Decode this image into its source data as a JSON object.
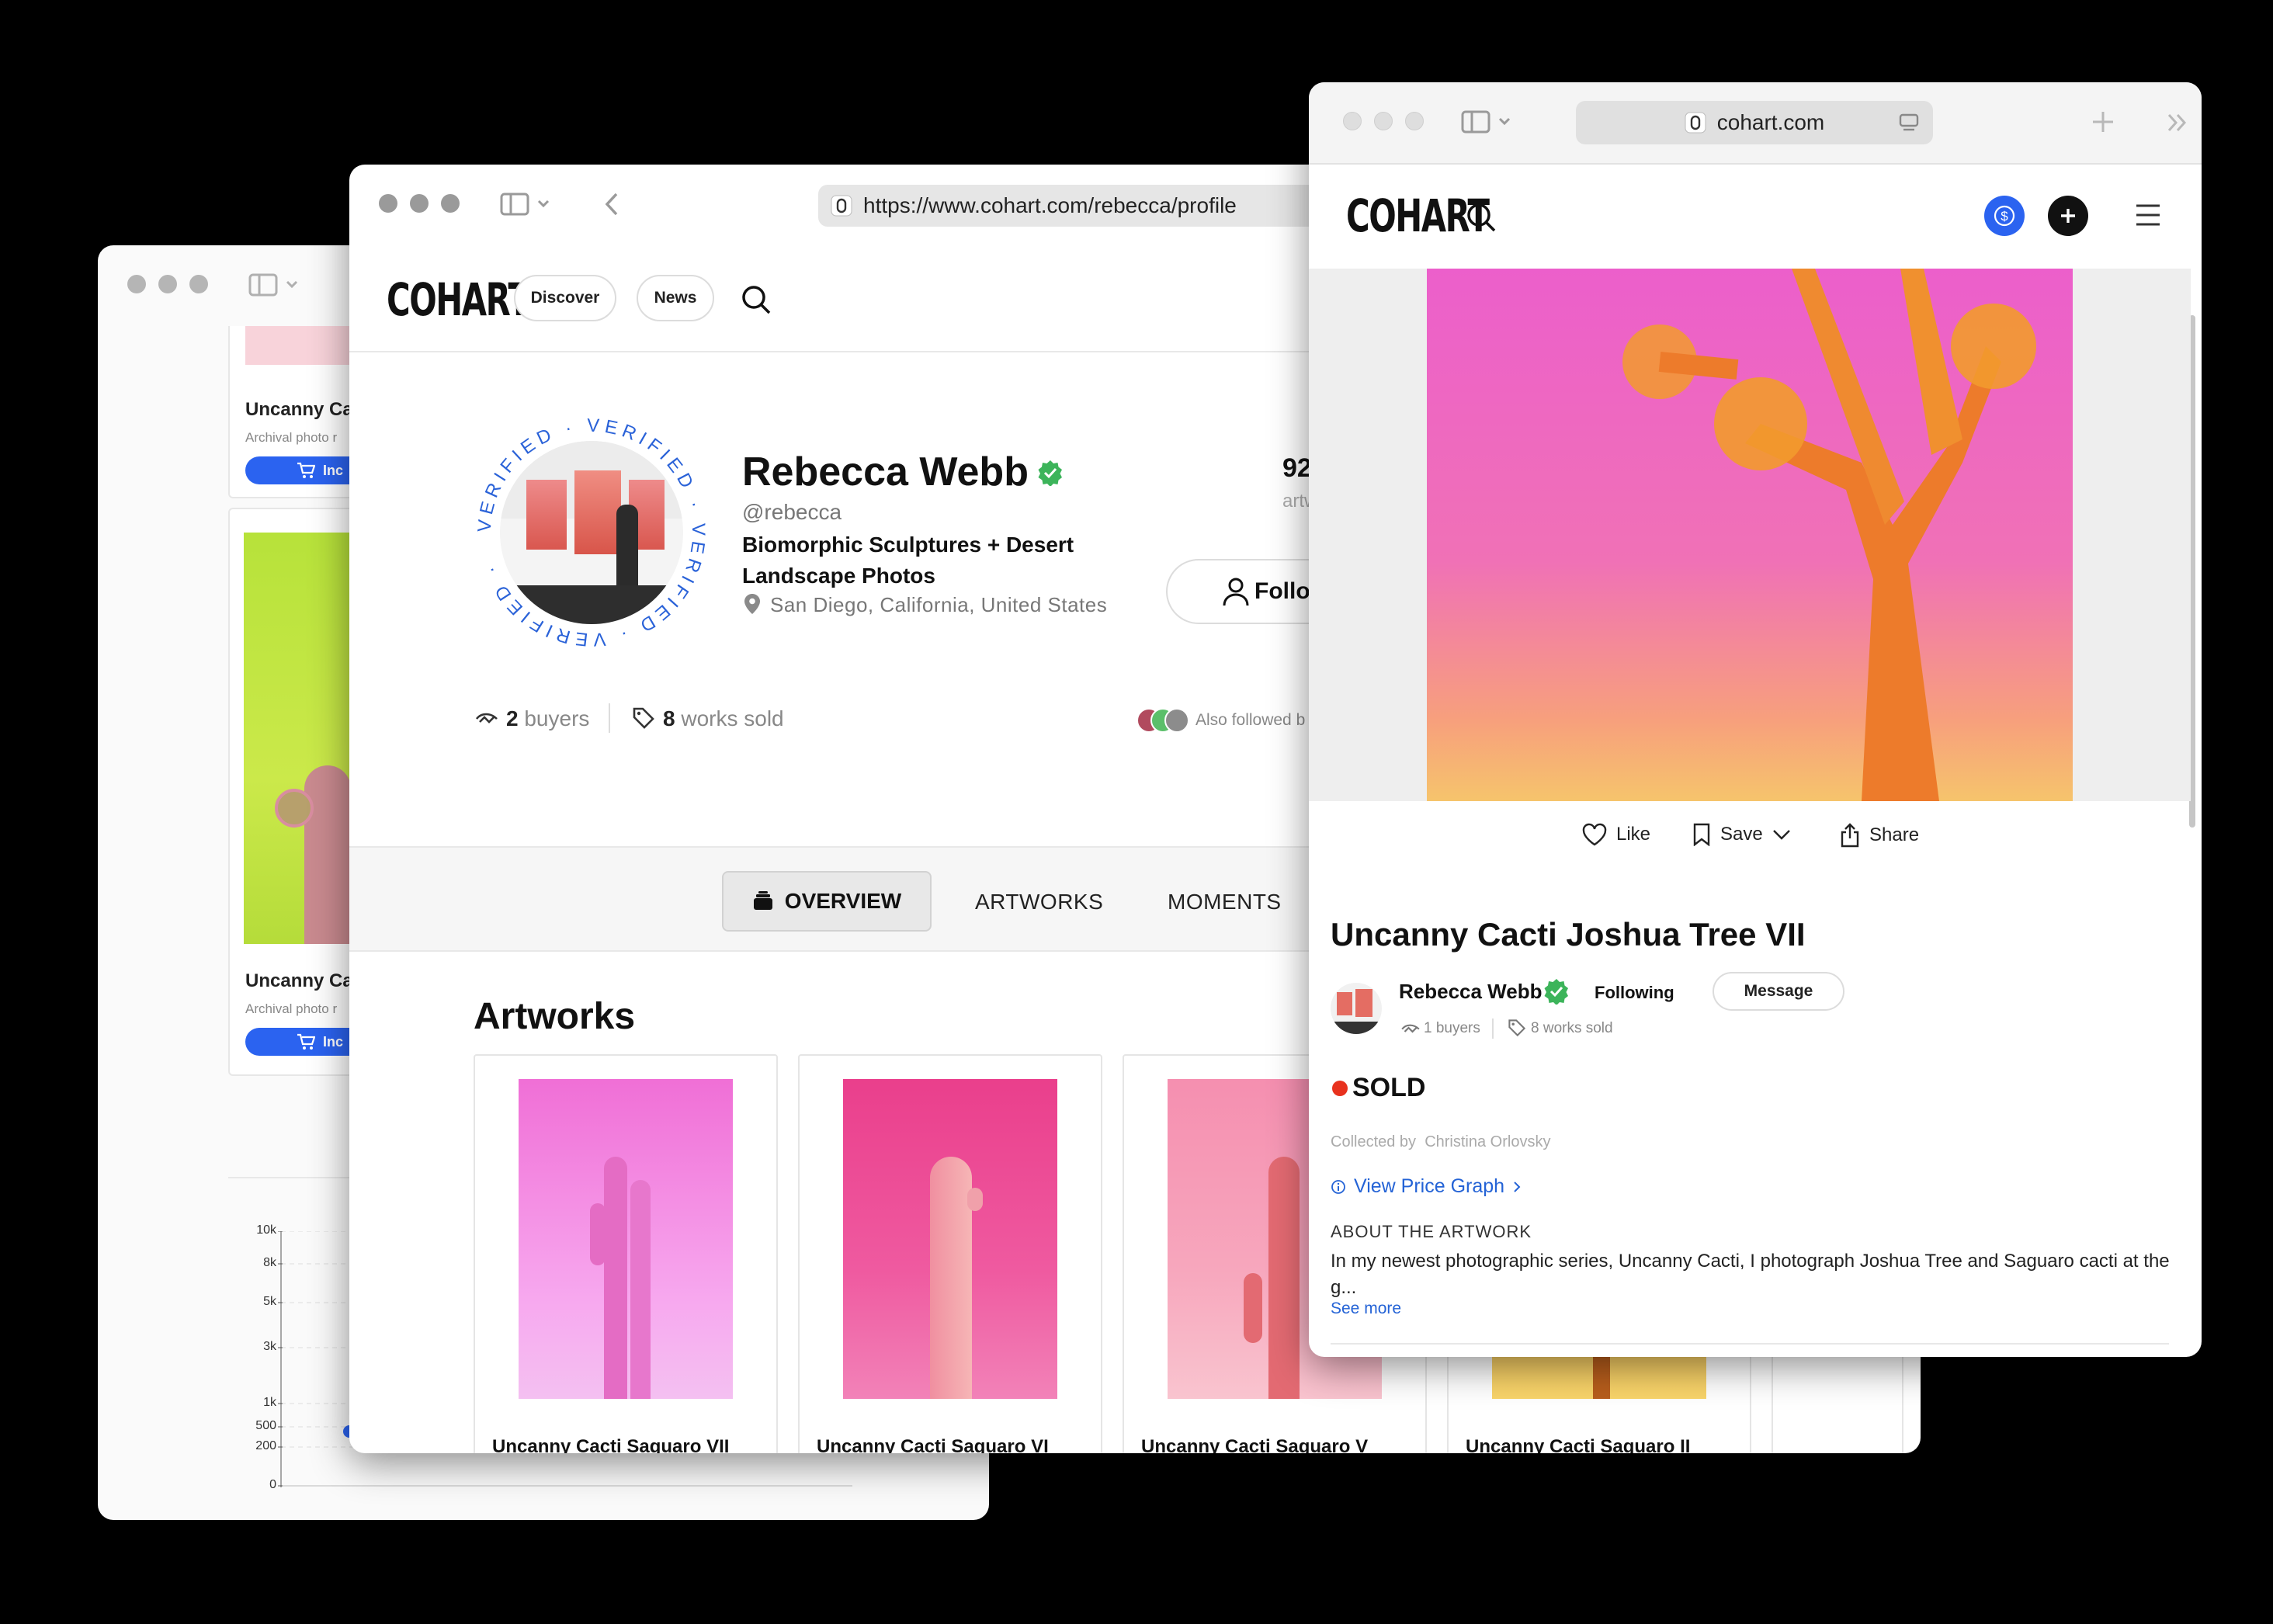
{
  "back_window": {
    "cards": [
      {
        "title": "Uncanny Ca",
        "subtitle": "Archival photo r",
        "button": "Inc"
      },
      {
        "title": "Uncanny Ca",
        "subtitle": "Archival photo r",
        "button": "Inc"
      }
    ]
  },
  "chart_data": {
    "type": "scatter",
    "y_ticks": [
      "10k",
      "8k",
      "5k",
      "3k",
      "1k",
      "500",
      "200",
      "0"
    ],
    "points": [
      {
        "y": 500
      }
    ],
    "grid": true,
    "title": "",
    "xlabel": "",
    "ylabel": ""
  },
  "profile_window": {
    "url": "https://www.cohart.com/rebecca/profile",
    "logo": "COHART",
    "nav": {
      "discover": "Discover",
      "news": "News"
    },
    "profile": {
      "name": "Rebecca Webb",
      "handle": "@rebecca",
      "bio_line1": "Biomorphic Sculptures + Desert",
      "bio_line2": "Landscape Photos",
      "location": "San Diego, California, United States",
      "badge_text": "VERIFIED · VERIFIED · VERIFIED · VERIFIED ·",
      "stat_count": "92",
      "stat_label": "artw",
      "follow_label": "Follow",
      "buyers_count": "2",
      "buyers_label": "buyers",
      "sold_count": "8",
      "sold_label": "works sold",
      "also_followed": "Also followed b"
    },
    "tabs": {
      "overview": "OVERVIEW",
      "artworks": "ARTWORKS",
      "moments": "MOMENTS"
    },
    "section_title": "Artworks",
    "artworks": [
      {
        "title": "Uncanny Cacti Saguaro VII"
      },
      {
        "title": "Uncanny Cacti Saguaro VI"
      },
      {
        "title": "Uncanny Cacti Saguaro V"
      },
      {
        "title": "Uncanny Cacti Saguaro II"
      }
    ]
  },
  "artwork_window": {
    "url": "cohart.com",
    "logo": "COHART",
    "actions": {
      "like": "Like",
      "save": "Save",
      "share": "Share"
    },
    "title": "Uncanny Cacti Joshua Tree VII",
    "artist": "Rebecca Webb",
    "following_label": "Following",
    "message_label": "Message",
    "buyers": "1 buyers",
    "works_sold": "8 works sold",
    "status": "SOLD",
    "collected_label": "Collected by",
    "collector": "Christina Orlovsky",
    "price_graph_link": "View Price Graph",
    "about_heading": "ABOUT THE ARTWORK",
    "about_text": "In my newest photographic series, Uncanny Cacti, I photograph Joshua Tree and Saguaro cacti at the g...",
    "see_more": "See more"
  },
  "colors": {
    "accent_blue": "#2b63f0",
    "verified_green": "#3cb45a",
    "sold_red": "#e8321e",
    "link_blue": "#2463d6"
  }
}
